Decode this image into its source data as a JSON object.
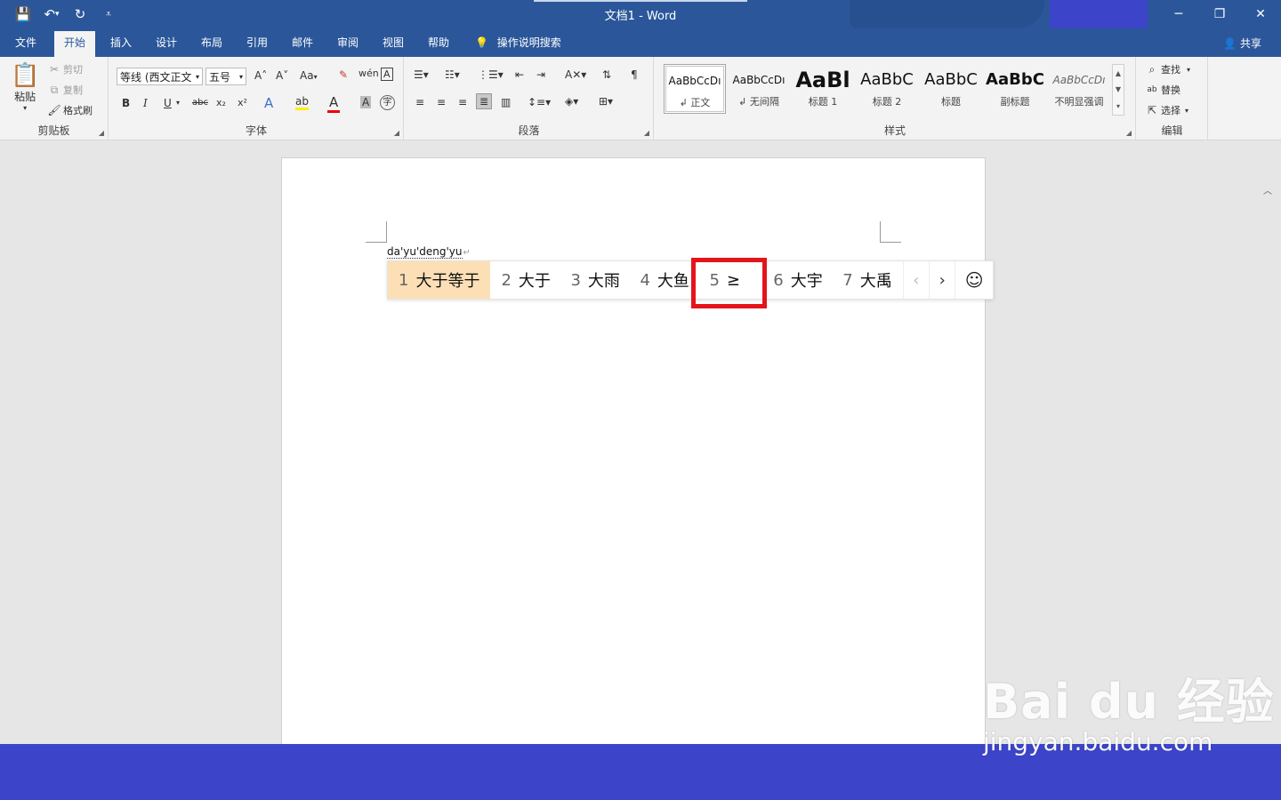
{
  "window": {
    "title": "文档1  -  Word",
    "accent_color": "#2b579a",
    "buttons": {
      "minimize": "─",
      "restore": "❐",
      "close": "✕"
    }
  },
  "qat": {
    "save_icon": "💾",
    "undo_icon": "↶",
    "undo_dropdown": "▾",
    "redo_icon": "↻",
    "customize_icon": "⩡"
  },
  "tabs": [
    {
      "label": "文件"
    },
    {
      "label": "开始"
    },
    {
      "label": "插入"
    },
    {
      "label": "设计"
    },
    {
      "label": "布局"
    },
    {
      "label": "引用"
    },
    {
      "label": "邮件"
    },
    {
      "label": "审阅"
    },
    {
      "label": "视图"
    },
    {
      "label": "帮助"
    }
  ],
  "search_tab": {
    "label": "操作说明搜索"
  },
  "share": {
    "label": "共享"
  },
  "ribbon": {
    "clipboard": {
      "label": "剪贴板",
      "paste": "粘贴",
      "cut": "剪切",
      "copy": "复制",
      "format_painter": "格式刷"
    },
    "font": {
      "label": "字体",
      "font_name": "等线 (西文正文",
      "font_size": "五号",
      "grow": "A˄",
      "shrink": "A˅",
      "case": "Aa",
      "bold": "B",
      "italic": "I",
      "underline": "U",
      "strike": "abc",
      "subscript": "x₂",
      "superscript": "x²"
    },
    "paragraph": {
      "label": "段落"
    },
    "styles": {
      "label": "样式",
      "items": [
        {
          "sample": "AaBbCcDı",
          "name": "↲ 正文"
        },
        {
          "sample": "AaBbCcDı",
          "name": "↲ 无间隔"
        },
        {
          "sample": "AaBl",
          "name": "标题 1"
        },
        {
          "sample": "AaBbC",
          "name": "标题 2"
        },
        {
          "sample": "AaBbC",
          "name": "标题"
        },
        {
          "sample": "AaBbC",
          "name": "副标题"
        },
        {
          "sample": "AaBbCcDı",
          "name": "不明显强调"
        }
      ]
    },
    "editing": {
      "label": "编辑",
      "find": "查找",
      "replace": "替换",
      "select": "选择"
    }
  },
  "document": {
    "typed_pinyin": "da'yu'deng'yu",
    "paragraph_mark": "↵"
  },
  "ime": {
    "candidates": [
      {
        "num": "1",
        "text": "大于等于"
      },
      {
        "num": "2",
        "text": "大于"
      },
      {
        "num": "3",
        "text": "大雨"
      },
      {
        "num": "4",
        "text": "大鱼"
      },
      {
        "num": "5",
        "text": "≥"
      },
      {
        "num": "6",
        "text": "大宇"
      },
      {
        "num": "7",
        "text": "大禹"
      }
    ],
    "prev": "‹",
    "next": "›",
    "emoji": "☺",
    "highlight_color": "#fddfb6"
  },
  "annotation": {
    "color": "#e4141b"
  },
  "watermark": {
    "brand": "Bai du 经验",
    "url": "jingyan.baidu.com"
  }
}
